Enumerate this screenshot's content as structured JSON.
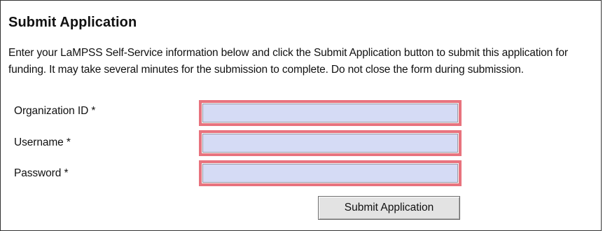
{
  "form": {
    "title": "Submit Application",
    "description": "Enter your LaMPSS Self-Service information below and click the Submit Application button to submit this application for funding. It may take several minutes for the submission to complete. Do not close the form during submission.",
    "fields": [
      {
        "label": "Organization ID *",
        "value": ""
      },
      {
        "label": "Username *",
        "value": ""
      },
      {
        "label": "Password *",
        "value": ""
      }
    ],
    "submit_label": "Submit Application"
  },
  "colors": {
    "required_border": "#e8737e",
    "input_fill": "#d5dbf5",
    "button_fill": "#e3e3e3"
  }
}
